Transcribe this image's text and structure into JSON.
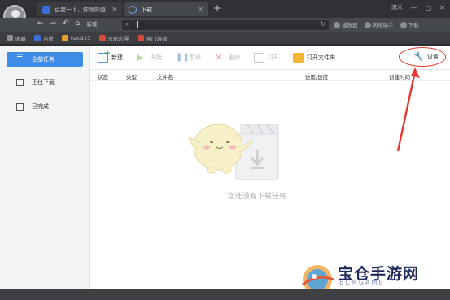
{
  "tabs": [
    {
      "label": "百度一下，你就知道",
      "close": "✕"
    },
    {
      "label": "下载",
      "close": "✕"
    }
  ],
  "new_tab": "+",
  "window": {
    "user": "流米",
    "minimize": "—",
    "maximize": "▢",
    "close": "✕"
  },
  "nav": {
    "back": "←",
    "forward": "→",
    "reload": "↶",
    "home": "⌂",
    "home_label": "新域"
  },
  "address": {
    "value": "",
    "search_icon": "search-icon",
    "refresh": "↻"
  },
  "right_tools": [
    "播放器",
    "网络助手",
    "下载"
  ],
  "bookmarks": [
    {
      "label": "收藏",
      "color": "#8a8e93"
    },
    {
      "label": "百度",
      "color": "#3a6fd8"
    },
    {
      "label": "hao123",
      "color": "#e2a12e"
    },
    {
      "label": "乐彩彩票",
      "color": "#d64b3a"
    },
    {
      "label": "热门游戏",
      "color": "#d64b3a"
    }
  ],
  "sidebar": {
    "items": [
      {
        "label": "全部任务",
        "active": true
      },
      {
        "label": "正在下载",
        "active": false
      },
      {
        "label": "已完成",
        "active": false
      }
    ]
  },
  "toolbar": {
    "new": "新建",
    "start": "开始",
    "pause": "暂停",
    "delete": "删除",
    "open": "打开",
    "open_folder": "打开文件夹",
    "settings": "设置"
  },
  "table": {
    "columns": [
      "状态",
      "类型",
      "文件名",
      "进度/速度",
      "创建时间"
    ]
  },
  "empty_message": "您还没有下载任务",
  "watermark": {
    "title": "宝仓手游网",
    "sub": "BCMGAME"
  },
  "colors": {
    "accent": "#3e8ce8",
    "annotation": "#e23a2e"
  }
}
